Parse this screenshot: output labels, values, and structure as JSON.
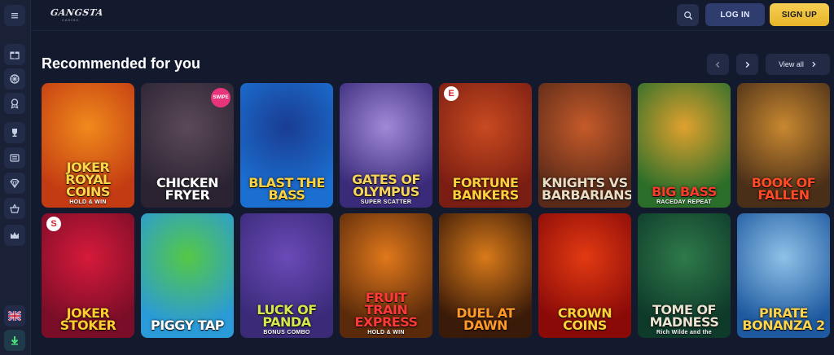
{
  "header": {
    "logo_text": "GANGSTA",
    "logo_sub": "CASINO",
    "search_icon": "search-icon",
    "login_label": "LOG IN",
    "signup_label": "SIGN UP"
  },
  "sidebar": {
    "menu_icon": "hamburger-icon",
    "items": [
      {
        "icon": "gift-icon"
      },
      {
        "icon": "wheel-icon"
      },
      {
        "icon": "badge-icon"
      },
      {
        "icon": "trophy-icon"
      },
      {
        "icon": "cashier-icon"
      },
      {
        "icon": "diamond-icon"
      },
      {
        "icon": "basket-icon"
      },
      {
        "icon": "crown-icon"
      }
    ],
    "language_icon": "uk-flag-icon",
    "download_icon": "download-icon"
  },
  "section": {
    "title": "Recommended for you",
    "prev_icon": "chevron-left-icon",
    "next_icon": "chevron-right-icon",
    "view_all_label": "View all"
  },
  "games": [
    {
      "title": "Joker Royal Coins",
      "sub": "HOLD & WIN",
      "bg1": "#c33b12",
      "bg2": "#f08a1c",
      "color": "#ffd64a"
    },
    {
      "title": "Chicken Fryer",
      "sub": "",
      "bg1": "#2b2332",
      "bg2": "#5b4a58",
      "color": "#ffffff",
      "badge": "SWIPE"
    },
    {
      "title": "Blast the Bass",
      "sub": "",
      "bg1": "#1b6fd1",
      "bg2": "#1a3c92",
      "color": "#ffd23e"
    },
    {
      "title": "Gates of Olympus",
      "sub": "SUPER SCATTER",
      "bg1": "#3a2a7a",
      "bg2": "#a08ad8",
      "color": "#f7d45a"
    },
    {
      "title": "Fortune Bankers",
      "sub": "",
      "bg1": "#7a1d12",
      "bg2": "#c84a20",
      "color": "#ffcf3c",
      "badge_e": "E"
    },
    {
      "title": "Knights vs Barbarians",
      "sub": "",
      "bg1": "#5a2a18",
      "bg2": "#c55a2a",
      "color": "#e9dcc2"
    },
    {
      "title": "Big Bass",
      "sub": "RACEDAY REPEAT",
      "bg1": "#2a6e2a",
      "bg2": "#e0a12e",
      "color": "#ff3a2a"
    },
    {
      "title": "Book of Fallen",
      "sub": "",
      "bg1": "#4a2f18",
      "bg2": "#c88830",
      "color": "#ff4a28"
    },
    {
      "title": "Joker Stoker",
      "sub": "",
      "bg1": "#7a0d28",
      "bg2": "#d61a3a",
      "color": "#ffce2e",
      "badge_e": "S"
    },
    {
      "title": "Piggy Tap",
      "sub": "",
      "bg1": "#2a9ad8",
      "bg2": "#55c846",
      "color": "#ffffff"
    },
    {
      "title": "Luck of Panda",
      "sub": "BONUS COMBO",
      "bg1": "#3a2a78",
      "bg2": "#6a4ab8",
      "color": "#d6e84a"
    },
    {
      "title": "Fruit Train Express",
      "sub": "HOLD & WIN",
      "bg1": "#5a2a0a",
      "bg2": "#e0781c",
      "color": "#ff3838"
    },
    {
      "title": "Duel at Dawn",
      "sub": "",
      "bg1": "#3a1a08",
      "bg2": "#d87a1a",
      "color": "#ff9a28"
    },
    {
      "title": "Crown Coins",
      "sub": "",
      "bg1": "#8a0a08",
      "bg2": "#e23a12",
      "color": "#ffd23a"
    },
    {
      "title": "Tome of Madness",
      "sub": "Rich Wilde and the",
      "bg1": "#0e3a2a",
      "bg2": "#2f7a4a",
      "color": "#e9e3d0"
    },
    {
      "title": "Pirate Bonanza 2",
      "sub": "",
      "bg1": "#1f5aa0",
      "bg2": "#8fc2e8",
      "color": "#ffd44a"
    }
  ]
}
